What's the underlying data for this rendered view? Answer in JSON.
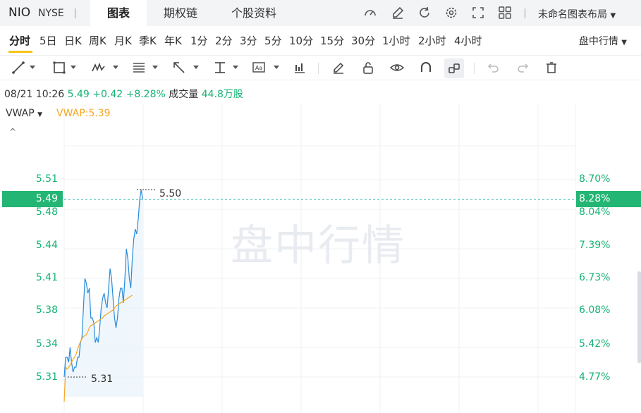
{
  "header": {
    "symbol": "NIO",
    "exchange": "NYSE",
    "tabs": [
      {
        "label": "图表",
        "active": true
      },
      {
        "label": "期权链",
        "active": false
      },
      {
        "label": "个股资料",
        "active": false
      }
    ],
    "toolbar_icons": [
      "speedometer-icon",
      "edit-icon",
      "refresh-icon",
      "settings-icon",
      "fullscreen-icon",
      "grid-icon"
    ],
    "layout_label": "未命名图表布局"
  },
  "periods": {
    "items": [
      "分时",
      "5日",
      "日K",
      "周K",
      "月K",
      "季K",
      "年K",
      "1分",
      "2分",
      "3分",
      "5分",
      "10分",
      "15分",
      "30分",
      "1小时",
      "2小时",
      "4小时"
    ],
    "active": "分时",
    "session_label": "盘中行情"
  },
  "draw_tools": [
    "line-tool-icon",
    "rectangle-tool-icon",
    "pattern-tool-icon",
    "fib-tool-icon",
    "arrow-tool-icon",
    "measure-tool-icon",
    "text-tool-icon",
    "indicator-icon",
    "pencil-icon",
    "lock-icon",
    "eye-icon",
    "magnet-icon",
    "link-icon",
    "undo-icon",
    "redo-icon",
    "trash-icon"
  ],
  "quote": {
    "datetime": "08/21 10:26",
    "price": "5.49",
    "change": "+0.42",
    "change_pct": "+8.28%",
    "volume_label": "成交量",
    "volume": "44.8万股"
  },
  "indicator": {
    "name": "VWAP",
    "value_label": "VWAP:5.39"
  },
  "colors": {
    "up": "#15b374",
    "price_line": "#2a8bd8",
    "vwap_line": "#f5a623"
  },
  "watermark": "盘中行情",
  "chart_data": {
    "type": "line",
    "ylim": [
      5.29,
      5.53
    ],
    "price_ticks": [
      "5.51",
      "5.48",
      "5.44",
      "5.41",
      "5.38",
      "5.34",
      "5.31"
    ],
    "pct_ticks": [
      "8.70%",
      "8.04%",
      "7.39%",
      "6.73%",
      "6.08%",
      "5.42%",
      "4.77%"
    ],
    "current_price_label": "5.49",
    "current_pct_label": "8.28%",
    "high_label": "5.50",
    "low_label": "5.31",
    "series": [
      {
        "values": [
          5.31,
          5.33,
          5.33,
          5.325,
          5.34,
          5.325,
          5.315,
          5.32,
          5.32,
          5.33,
          5.33,
          5.345,
          5.35,
          5.38,
          5.41,
          5.405,
          5.395,
          5.4,
          5.37,
          5.37,
          5.365,
          5.345,
          5.35,
          5.345,
          5.36,
          5.38,
          5.39,
          5.395,
          5.385,
          5.38,
          5.4,
          5.42,
          5.41,
          5.39,
          5.37,
          5.36,
          5.37,
          5.39,
          5.4,
          5.4,
          5.385,
          5.41,
          5.44,
          5.43,
          5.41,
          5.4,
          5.43,
          5.45,
          5.46,
          5.455,
          5.47,
          5.49,
          5.5,
          5.49
        ]
      },
      {
        "values": [
          5.285,
          5.32,
          5.318,
          5.32,
          5.322,
          5.325,
          5.328,
          5.33,
          5.333,
          5.338,
          5.342,
          5.346,
          5.349,
          5.351,
          5.352,
          5.353,
          5.356,
          5.36,
          5.362,
          5.363,
          5.364,
          5.365,
          5.366,
          5.367,
          5.368,
          5.369,
          5.37,
          5.372,
          5.373,
          5.374,
          5.375,
          5.376,
          5.377,
          5.378,
          5.38,
          5.382,
          5.383,
          5.384,
          5.385,
          5.386,
          5.387,
          5.388,
          5.389,
          5.39,
          5.391,
          5.392,
          5.393
        ]
      }
    ]
  }
}
